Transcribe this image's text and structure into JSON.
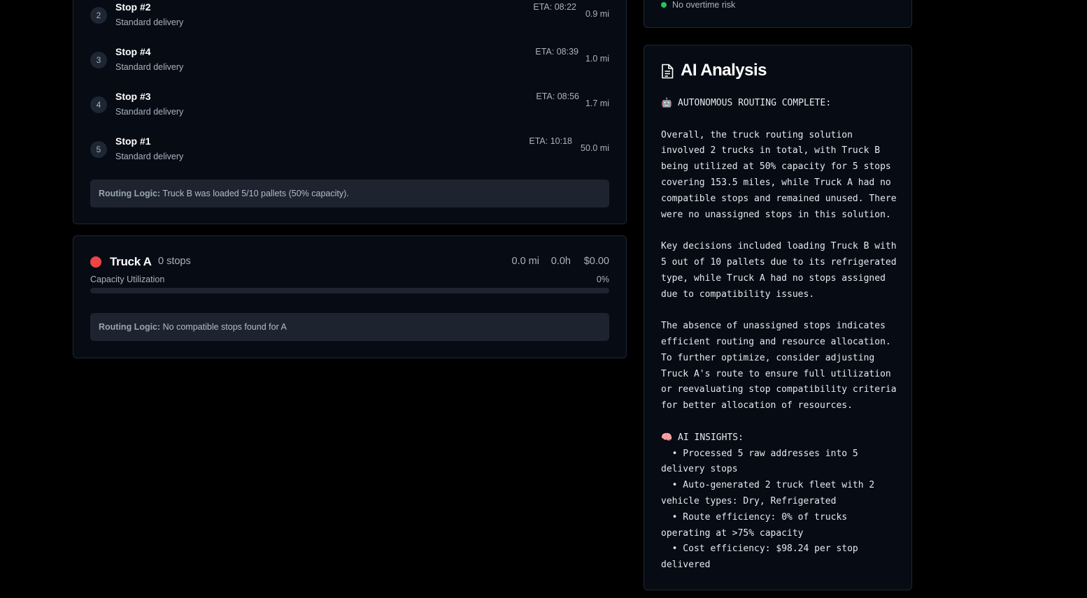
{
  "truck_b": {
    "stops": [
      {
        "num": "2",
        "title": "Stop #2",
        "type": "Standard delivery",
        "eta": "ETA: 08:22",
        "dist": "0.9 mi"
      },
      {
        "num": "3",
        "title": "Stop #4",
        "type": "Standard delivery",
        "eta": "ETA: 08:39",
        "dist": "1.0 mi"
      },
      {
        "num": "4",
        "title": "Stop #3",
        "type": "Standard delivery",
        "eta": "ETA: 08:56",
        "dist": "1.7 mi"
      },
      {
        "num": "5",
        "title": "Stop #1",
        "type": "Standard delivery",
        "eta": "ETA: 10:18",
        "dist": "50.0 mi"
      }
    ],
    "routing_logic_label": "Routing Logic:",
    "routing_logic_text": "Truck B was loaded 5/10 pallets (50% capacity)."
  },
  "truck_a": {
    "name": "Truck A",
    "stops_count": "0 stops",
    "distance": "0.0 mi",
    "hours": "0.0h",
    "cost": "$0.00",
    "capacity_label": "Capacity Utilization",
    "capacity_pct": "0%",
    "capacity_fraction": 0,
    "routing_logic_label": "Routing Logic:",
    "routing_logic_text": "No compatible stops found for A",
    "color": "#ef4444"
  },
  "overtime": {
    "status": "No overtime risk",
    "color": "#22c55e"
  },
  "ai_analysis": {
    "title": "AI Analysis",
    "icon": "document-icon",
    "body": "🤖 AUTONOMOUS ROUTING COMPLETE:\n\nOverall, the truck routing solution involved 2 trucks in total, with Truck B being utilized at 50% capacity for 5 stops covering 153.5 miles, while Truck A had no compatible stops and remained unused. There were no unassigned stops in this solution.\n\nKey decisions included loading Truck B with 5 out of 10 pallets due to its refrigerated type, while Truck A had no stops assigned due to compatibility issues.\n\nThe absence of unassigned stops indicates efficient routing and resource allocation. To further optimize, consider adjusting Truck A's route to ensure full utilization or reevaluating stop compatibility criteria for better allocation of resources.\n\n🧠 AI INSIGHTS:\n  • Processed 5 raw addresses into 5 delivery stops\n  • Auto-generated 2 truck fleet with 2 vehicle types: Dry, Refrigerated\n  • Route efficiency: 0% of trucks operating at >75% capacity\n  • Cost efficiency: $98.24 per stop delivered"
  }
}
